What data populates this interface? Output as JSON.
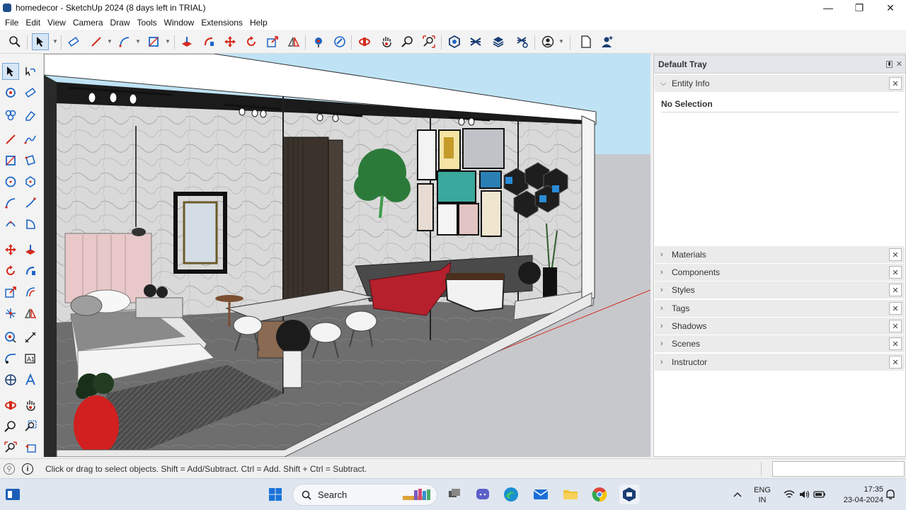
{
  "window": {
    "title": "homedecor - SketchUp 2024 (8 days left in TRIAL)",
    "minimize": "—",
    "restore": "❐",
    "close": "✕"
  },
  "menu": [
    "File",
    "Edit",
    "View",
    "Camera",
    "Draw",
    "Tools",
    "Window",
    "Extensions",
    "Help"
  ],
  "tray": {
    "title": "Default Tray",
    "entity_info": {
      "label": "Entity Info",
      "selection": "No Selection"
    },
    "panels": [
      "Materials",
      "Components",
      "Styles",
      "Tags",
      "Shadows",
      "Scenes",
      "Instructor"
    ]
  },
  "status": {
    "hint": "Click or drag to select objects. Shift = Add/Subtract. Ctrl = Add. Shift + Ctrl = Subtract.",
    "measurements_value": ""
  },
  "taskbar": {
    "search_label": "Search",
    "lang_line1": "ENG",
    "lang_line2": "IN",
    "time": "17:35",
    "date": "23-04-2024"
  },
  "colors": {
    "accent_red": "#d52b1e",
    "accent_blue": "#1e66c8",
    "sky": "#bfe3f5",
    "ground": "#c7c8cc"
  }
}
